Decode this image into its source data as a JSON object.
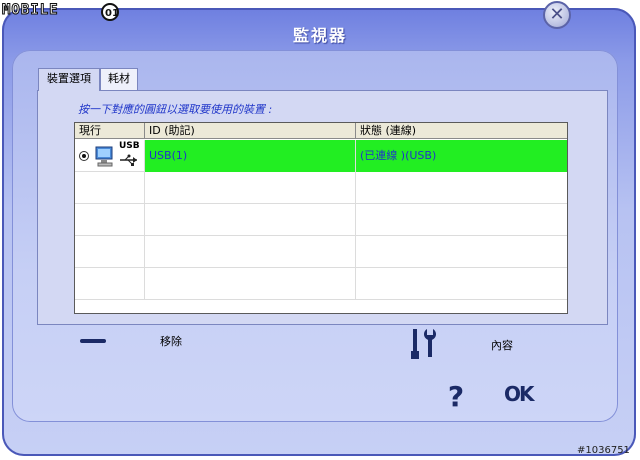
{
  "watermark": {
    "text": "MOBILE"
  },
  "image_id": "#1036751",
  "window": {
    "title": "監視器",
    "close_symbol": "✕"
  },
  "tabs": [
    {
      "label": "裝置選項",
      "active": true
    },
    {
      "label": "耗材",
      "active": false
    }
  ],
  "instruction": "按一下對應的圓鈕以選取要使用的裝置 :",
  "table": {
    "headers": [
      "現行",
      "ID (助記)",
      "狀態 (連線)"
    ],
    "rows": [
      {
        "selected": true,
        "icon": "pc-usb-icon",
        "usb_label": "USB",
        "id": "USB(1)",
        "status": "(已連線 )(USB)",
        "highlight_color": "#22ee22"
      },
      {
        "selected": false,
        "id": "",
        "status": ""
      },
      {
        "selected": false,
        "id": "",
        "status": ""
      },
      {
        "selected": false,
        "id": "",
        "status": ""
      },
      {
        "selected": false,
        "id": "",
        "status": ""
      }
    ]
  },
  "actions": {
    "remove_label": "移除",
    "properties_label": "內容",
    "help_symbol": "?",
    "ok_label": "OK"
  },
  "colors": {
    "accent_text": "#1f35c9",
    "connected_bg": "#22ee22",
    "window_bg": "#b7c2f2"
  }
}
